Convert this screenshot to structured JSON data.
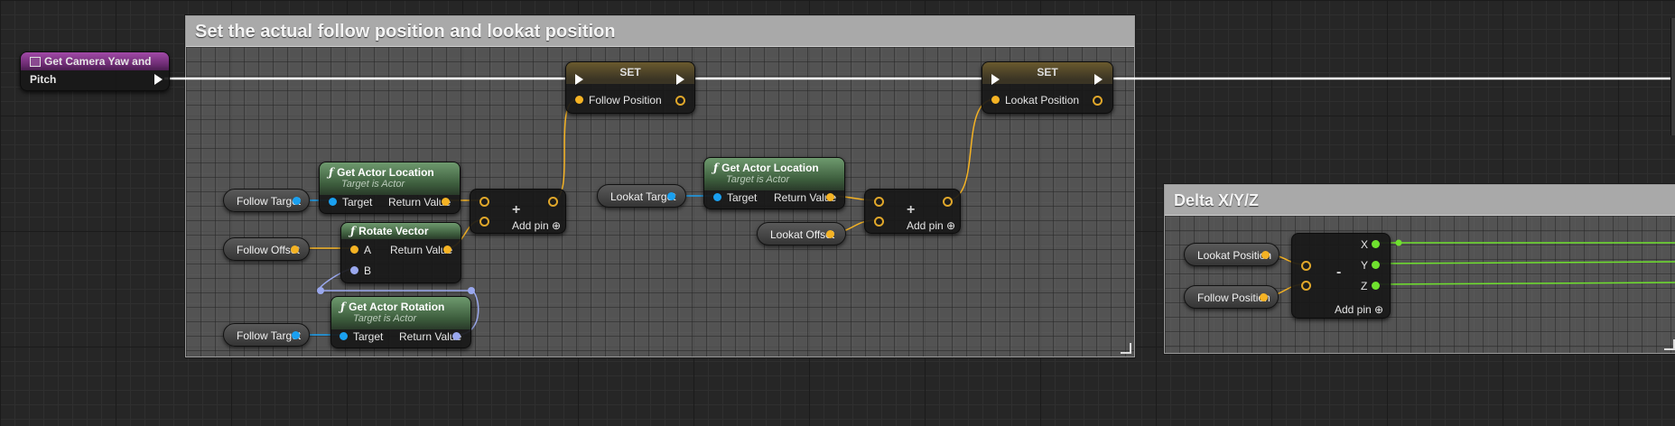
{
  "comments": {
    "main_title": "Set the actual follow position and lookat position",
    "delta_title": "Delta X/Y/Z"
  },
  "event_node": {
    "title": "Get Camera Yaw and Pitch",
    "icon": "function-icon"
  },
  "set_nodes": [
    {
      "title": "SET",
      "var": "Follow Position"
    },
    {
      "title": "SET",
      "var": "Lookat Position"
    }
  ],
  "get_actor_location_1": {
    "title": "Get Actor Location",
    "subtitle": "Target is Actor",
    "in_pin": "Target",
    "out_pin": "Return Value"
  },
  "get_actor_location_2": {
    "title": "Get Actor Location",
    "subtitle": "Target is Actor",
    "in_pin": "Target",
    "out_pin": "Return Value"
  },
  "rotate_vector": {
    "title": "Rotate Vector",
    "pin_a": "A",
    "pin_b": "B",
    "out_pin": "Return Value"
  },
  "get_actor_rotation": {
    "title": "Get Actor Rotation",
    "subtitle": "Target is Actor",
    "in_pin": "Target",
    "out_pin": "Return Value"
  },
  "variables": {
    "follow_target_1": "Follow Target",
    "follow_offset": "Follow Offset",
    "follow_target_2": "Follow Target",
    "lookat_target": "Lookat Target",
    "lookat_offset": "Lookat Offset",
    "lookat_position": "Lookat Position",
    "follow_position": "Follow Position"
  },
  "add_nodes": {
    "plus": "+",
    "minus": "-",
    "add_pin": "Add pin"
  },
  "break_pins": {
    "x": "X",
    "y": "Y",
    "z": "Z"
  },
  "colors": {
    "vector_pin": "#f5b324",
    "object_pin": "#1aa0f0",
    "rotator_pin": "#9aa8ee",
    "float_pin": "#6fe12e",
    "exec_wire": "#ffffff"
  }
}
